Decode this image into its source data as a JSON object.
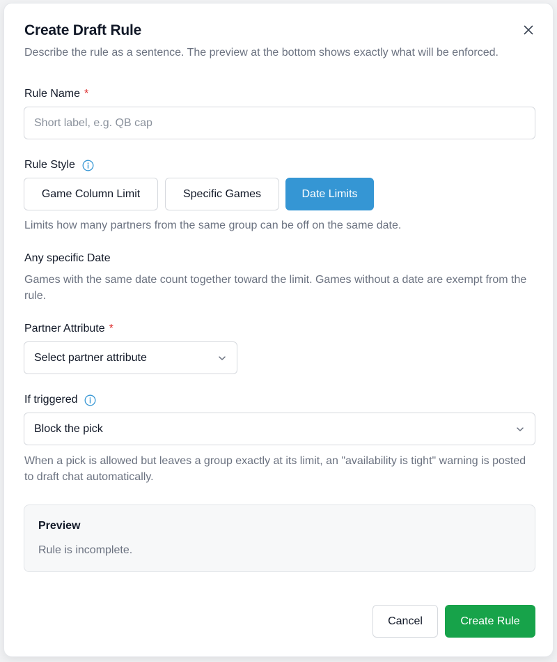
{
  "dialog": {
    "title": "Create Draft Rule",
    "description": "Describe the rule as a sentence. The preview at the bottom shows exactly what will be enforced."
  },
  "rule_name": {
    "label": "Rule Name",
    "required_mark": "*",
    "value": "",
    "placeholder": "Short label, e.g. QB cap"
  },
  "rule_style": {
    "label": "Rule Style",
    "options": [
      "Game Column Limit",
      "Specific Games",
      "Date Limits"
    ],
    "selected": "Date Limits",
    "help": "Limits how many partners from the same group can be off on the same date."
  },
  "specific_date": {
    "heading": "Any specific Date",
    "help": "Games with the same date count together toward the limit. Games without a date are exempt from the rule."
  },
  "partner_attribute": {
    "label": "Partner Attribute",
    "required_mark": "*",
    "value": "Select partner attribute"
  },
  "if_triggered": {
    "label": "If triggered",
    "value": "Block the pick",
    "help": "When a pick is allowed but leaves a group exactly at its limit, an \"availability is tight\" warning is posted to draft chat automatically."
  },
  "preview": {
    "heading": "Preview",
    "text": "Rule is incomplete."
  },
  "actions": {
    "cancel": "Cancel",
    "submit": "Create Rule"
  },
  "icons": {
    "close": "close-icon",
    "info": "info-icon",
    "chevron": "chevron-down-icon"
  },
  "colors": {
    "accent": "#3596d4",
    "primary_button": "#17a34a",
    "required": "#dc2626",
    "info": "#3596d4"
  }
}
